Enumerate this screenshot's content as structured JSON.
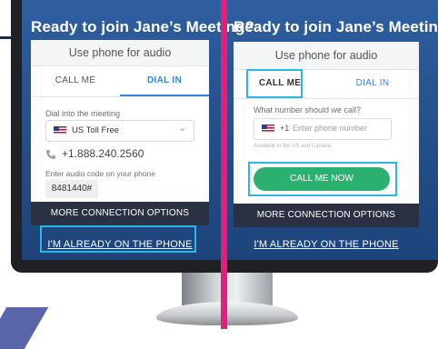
{
  "left": {
    "title": "Ready to join Jane’s Meeting?",
    "use_phone": "Use phone for audio",
    "tabs": [
      "CALL ME",
      "DIAL IN"
    ],
    "active_tab": "DIAL IN",
    "dial_label": "Dial into the meeting",
    "country_select": "US Toll Free",
    "phone_number": "+1.888.240.2560",
    "code_label": "Enter audio code on your phone",
    "code_value": "8481440#",
    "more_options": "MORE CONNECTION OPTIONS",
    "already": "I'M ALREADY ON THE PHONE"
  },
  "right": {
    "title": "Ready to join Jane’s Meeting?",
    "use_phone": "Use phone for audio",
    "tabs": [
      "CALL ME",
      "DIAL IN"
    ],
    "active_tab": "CALL ME",
    "question": "What number should we call?",
    "country_code": "+1",
    "phone_placeholder": "Enter phone number",
    "available_note": "Available in the US and Canada",
    "call_button": "CALL ME NOW",
    "more_options": "MORE CONNECTION OPTIONS",
    "already": "I'M ALREADY ON THE PHONE"
  },
  "colors": {
    "screen_bg": "#2a5896",
    "accent_blue": "#2f86d6",
    "highlight": "#2bb6e6",
    "divider": "#e81c7c",
    "green": "#2bb070",
    "dark_bar": "#2a3142"
  },
  "icons": {
    "phone": "phone-icon",
    "chevron": "chevron-down-icon",
    "flag": "us-flag-icon"
  }
}
